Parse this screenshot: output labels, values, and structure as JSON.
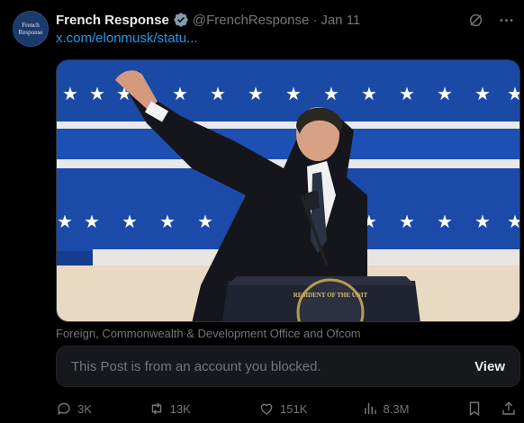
{
  "tweet": {
    "avatar_text": "French Response",
    "name": "French Response",
    "handle": "@FrenchResponse",
    "separator": "·",
    "date": "Jan 11",
    "link": "x.com/elonmusk/statu...",
    "media_caption": "Foreign, Commonwealth & Development Office and Ofcom",
    "blocked_notice": "This Post is from an account you blocked.",
    "view_label": "View",
    "seal_text": "RESIDENT OF THE UNIT"
  },
  "stats": {
    "replies": "3K",
    "reposts": "13K",
    "likes": "151K",
    "views": "8.3M"
  },
  "colors": {
    "accent": "#1d9bf0",
    "muted": "#71767b",
    "text": "#e7e9ea",
    "background": "#000000"
  },
  "icons": [
    "verified-badge-icon",
    "grok-icon",
    "more-icon",
    "reply-icon",
    "repost-icon",
    "like-icon",
    "views-icon",
    "bookmark-icon",
    "share-icon"
  ]
}
